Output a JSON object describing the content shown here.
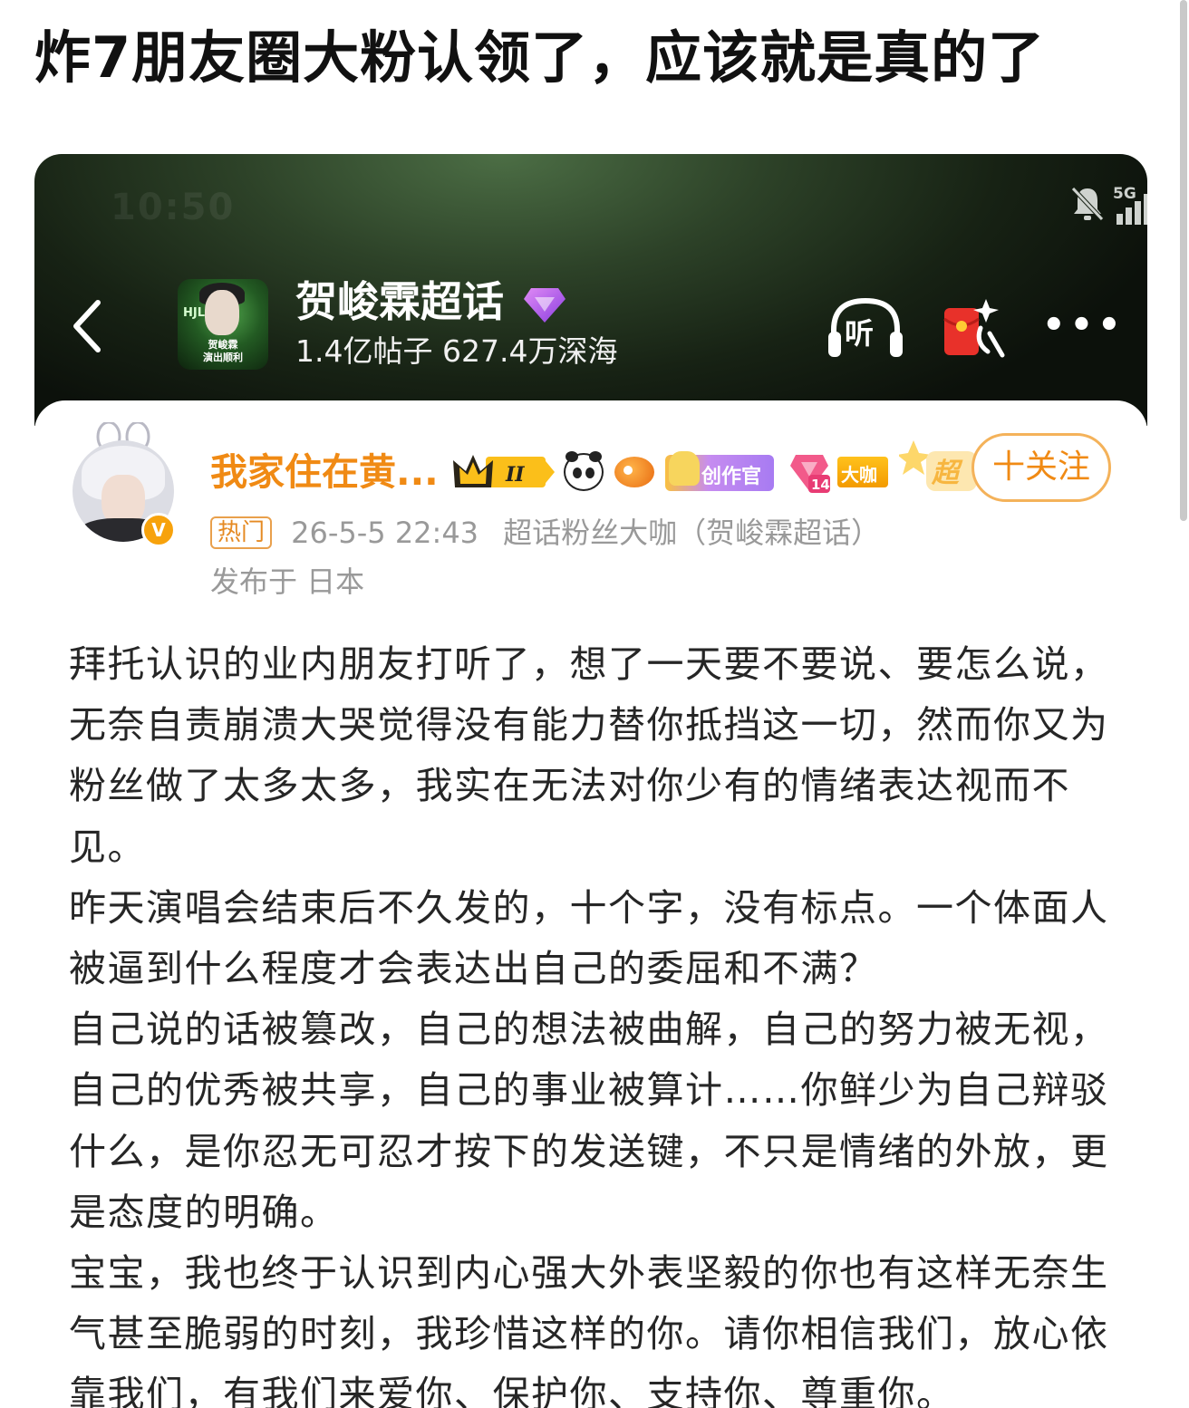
{
  "post": {
    "title": "炸7朋友圈大粉认领了，应该就是真的了"
  },
  "status_bar": {
    "time": "10:50",
    "network": "5G",
    "wifi_level": "6",
    "battery": "4"
  },
  "header": {
    "topic_name": "贺峻霖超话",
    "stats": "1.4亿帖子 627.4万深海",
    "thumb_caption_1": "贺峻霖",
    "thumb_caption_2": "演出顺利",
    "thumb_mark": "HJL",
    "listen_label": "听",
    "more_label": "•••"
  },
  "user": {
    "name": "我家住在黄...",
    "verify_icon_label": "V",
    "level_badge": "II",
    "creator_badge": "创作官",
    "gem_badge": "14",
    "dakai_badge": "大咖",
    "super_badge": "超",
    "follow_label": "十关注"
  },
  "meta": {
    "hot_tag": "热门",
    "time": "26-5-5 22:43",
    "source": "超话粉丝大咖（贺峻霖超话）",
    "location": "发布于 日本"
  },
  "body": {
    "paragraphs": [
      "拜托认识的业内朋友打听了，想了一天要不要说、要怎么说，无奈自责崩溃大哭觉得没有能力替你抵挡这一切，然而你又为粉丝做了太多太多，我实在无法对你少有的情绪表达视而不见。",
      "昨天演唱会结束后不久发的，十个字，没有标点。一个体面人被逼到什么程度才会表达出自己的委屈和不满？",
      "自己说的话被篡改，自己的想法被曲解，自己的努力被无视，自己的优秀被共享，自己的事业被算计……你鲜少为自己辩驳什么，是你忍无可忍才按下的发送键，不只是情绪的外放，更是态度的明确。",
      "宝宝，我也终于认识到内心强大外表坚毅的你也有这样无奈生气甚至脆弱的时刻，我珍惜这样的你。请你相信我们，放心依靠我们，有我们来爱你、保护你、支持你、尊重你。"
    ]
  },
  "colors": {
    "username": "#f08a14",
    "follow_border": "#f4b25a",
    "meta_gray": "#999999",
    "header_dark": "#172214",
    "header_glow": "#4c6e45"
  },
  "icons": {
    "back": "chevron-left-icon",
    "mute": "bell-off-icon",
    "signal": "signal-icon",
    "wifi": "wifi-icon",
    "diamond": "diamond-icon",
    "listen": "headphones-icon",
    "redpacket": "red-packet-icon"
  }
}
